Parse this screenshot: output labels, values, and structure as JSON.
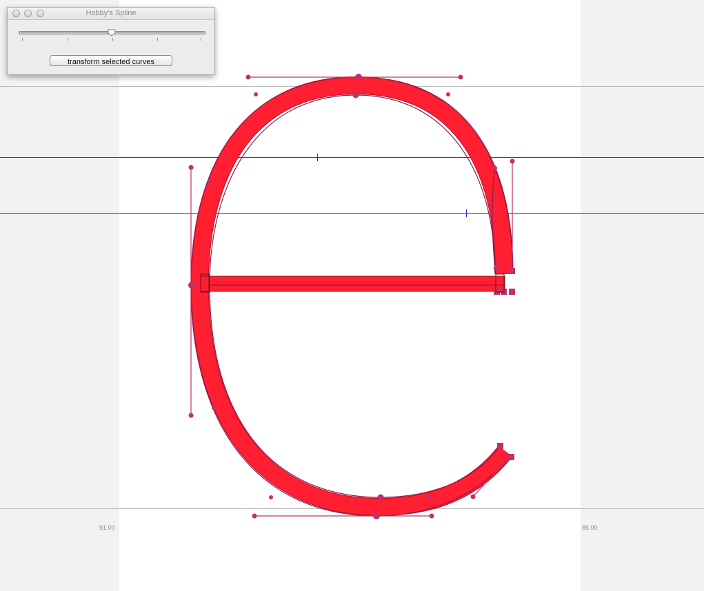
{
  "palette": {
    "title": "Hobby's Spline",
    "slider_value": 0.5,
    "slider_ticks": 5,
    "button_label": "transform selected curves"
  },
  "metrics": {
    "left_sidebearing": "91.00",
    "right_sidebearing": "85.00"
  },
  "colors": {
    "glyph_fill": "#ff1f30",
    "control_points": "#c0306a",
    "guides": "#2a2ad0",
    "metric_lines": "#b9b9b9"
  },
  "glyph": {
    "character": "e"
  }
}
